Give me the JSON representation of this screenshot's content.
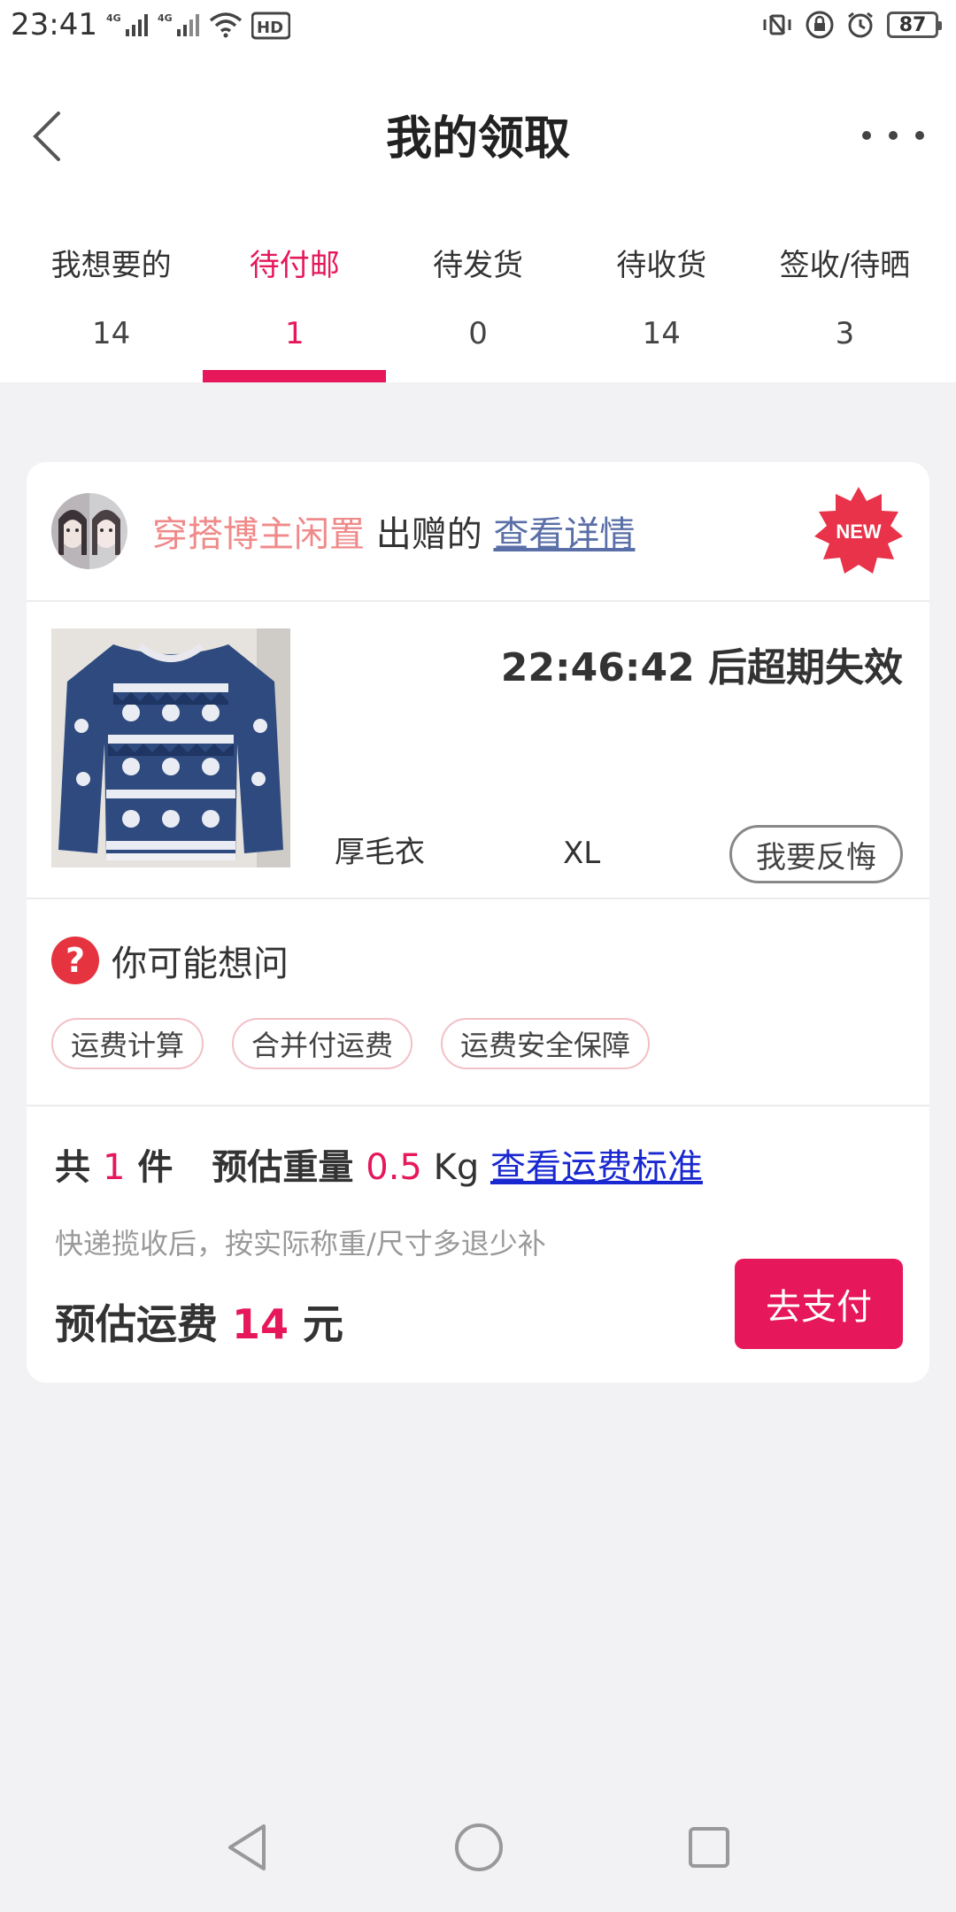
{
  "status_bar": {
    "time": "23:41",
    "signal1": "4G",
    "signal2": "4G",
    "hd": "HD",
    "battery": "87"
  },
  "header": {
    "title": "我的领取"
  },
  "tabs": [
    {
      "label": "我想要的",
      "count": "14",
      "active": false
    },
    {
      "label": "待付邮",
      "count": "1",
      "active": true
    },
    {
      "label": "待发货",
      "count": "0",
      "active": false
    },
    {
      "label": "待收货",
      "count": "14",
      "active": false
    },
    {
      "label": "签收/待晒",
      "count": "3",
      "active": false
    }
  ],
  "card": {
    "gift": {
      "user": "穿搭博主闲置",
      "action": " 出赠的 ",
      "link": "查看详情",
      "badge": "NEW"
    },
    "product": {
      "countdown": "22:46:42 后超期失效",
      "name": "厚毛衣",
      "size": "XL",
      "regret_button": "我要反悔"
    },
    "faq": {
      "title": "你可能想问",
      "icon": "?",
      "chips": [
        "运费计算",
        "合并付运费",
        "运费安全保障"
      ]
    },
    "summary": {
      "total_prefix": "共 ",
      "total_count": "1",
      "total_suffix": " 件",
      "weight_label": "预估重量 ",
      "weight_value": "0.5",
      "weight_unit": " Kg ",
      "fee_link": "查看运费标准",
      "note": "快递揽收后，按实际称重/尺寸多退少补",
      "fee_label": "预估运费 ",
      "fee_value": "14",
      "fee_unit": " 元",
      "pay_button": "去支付"
    }
  },
  "colors": {
    "accent": "#e6175a",
    "link": "#1a28d0",
    "muted": "#999999"
  }
}
